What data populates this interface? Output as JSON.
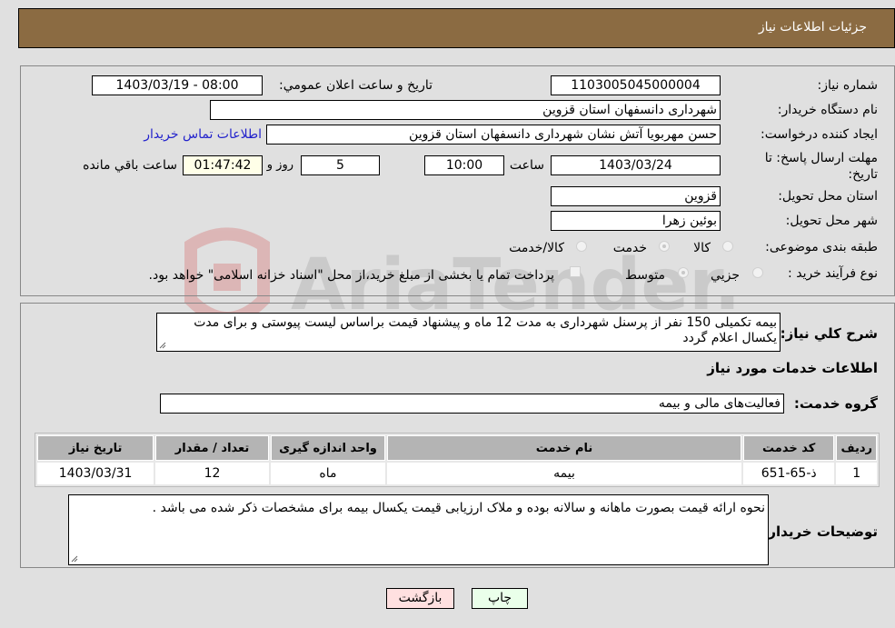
{
  "header": {
    "title": "جزئيات اطلاعات نياز"
  },
  "fields": {
    "need_number": {
      "label": "شماره نياز:",
      "value": "1103005045000004"
    },
    "announce": {
      "label": "تاريخ و ساعت اعلان عمومي:",
      "value": "1403/03/19 - 08:00"
    },
    "buyer_org": {
      "label": "نام دستگاه خريدار:",
      "value": "شهرداری دانسفهان استان قزوين"
    },
    "requester": {
      "label": "ايجاد كننده درخواست:",
      "value": "حسن مهربويا آتش نشان شهرداری دانسفهان استان قزوين"
    },
    "contact_link": "اطلاعات تماس خريدار",
    "deadline": {
      "label": "مهلت ارسال پاسخ: تا تاريخ:",
      "date": "1403/03/24",
      "time_label": "ساعت",
      "time": "10:00",
      "days": "5",
      "days_label": "روز و",
      "remaining": "01:47:42",
      "remaining_label": "ساعت باقي مانده"
    },
    "province": {
      "label": "استان محل تحويل:",
      "value": "قزوين"
    },
    "city": {
      "label": "شهر محل تحويل:",
      "value": "بوئين زهرا"
    },
    "category": {
      "label": "طبقه بندی موضوعی:",
      "options": [
        "كالا",
        "خدمت",
        "كالا/خدمت"
      ],
      "selected": "خدمت"
    },
    "purchase_type": {
      "label": "نوع فرآيند خريد :",
      "options": [
        "جزيي",
        "متوسط"
      ],
      "selected": "متوسط",
      "treasury_note": "پرداخت تمام يا بخشی از مبلغ خريد،از محل \"اسناد خزانه اسلامی\" خواهد بود."
    }
  },
  "description": {
    "label": "شرح كلي نياز:",
    "value": "بيمه تكميلی 150 نفر از پرسنل شهرداری به مدت 12 ماه و پيشنهاد قيمت براساس ليست پيوستی و برای مدت يكسال اعلام گردد"
  },
  "services_section": {
    "title": "اطلاعات خدمات مورد نياز"
  },
  "service_group": {
    "label": "گروه خدمت:",
    "value": "فعاليت‌های مالی و بيمه"
  },
  "table": {
    "headers": [
      "رديف",
      "كد خدمت",
      "نام خدمت",
      "واحد اندازه گيری",
      "تعداد / مقدار",
      "تاريخ نياز"
    ],
    "rows": [
      [
        "1",
        "ذ-65-651",
        "بيمه",
        "ماه",
        "12",
        "1403/03/31"
      ]
    ]
  },
  "buyer_notes": {
    "label": "توضيحات خريدار:",
    "value": "نحوه ارائه قيمت بصورت ماهانه و سالانه بوده و ملاک ارزيابی قيمت يكسال بيمه برای مشخصات ذكر شده می باشد ."
  },
  "buttons": {
    "print": "چاپ",
    "back": "بازگشت"
  },
  "colors": {
    "header_bg": "#8b6b42",
    "print_bg": "#eaffea",
    "back_bg": "#ffe0e0",
    "link": "#2222cc"
  },
  "watermark": {
    "text": "AriaTender.neT"
  }
}
